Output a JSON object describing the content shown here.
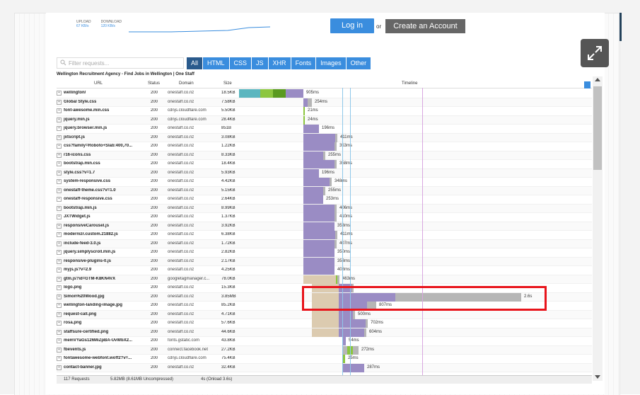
{
  "header": {
    "upload_label": "UPLOAD",
    "upload_value": "67 KB/s",
    "download_label": "DOWNLOAD",
    "download_value": "120 KB/s",
    "login_label": "Log in",
    "or_label": "or",
    "create_label": "Create an Account"
  },
  "filter": {
    "placeholder": "Filter requests...",
    "tabs": [
      "All",
      "HTML",
      "CSS",
      "JS",
      "XHR",
      "Fonts",
      "Images",
      "Other"
    ],
    "active_tab": "All"
  },
  "page_title": "Wellington Recruitment Agency - Find Jobs in Wellington | One Staff",
  "columns": {
    "url": "URL",
    "status": "Status",
    "domain": "Domain",
    "size": "Size",
    "timeline": "Timeline"
  },
  "colors": {
    "accent": "#3a8dde",
    "active_tab": "#2a5a8c",
    "highlight": "#e8141b",
    "bar_purple": "#9a8cc4",
    "bar_gray": "#b6b6b6",
    "bar_tan": "#dccbb0",
    "bar_teal": "#5bb6bf",
    "bar_green": "#8cc63f"
  },
  "rows": [
    {
      "url": "wellington/",
      "status": "200",
      "domain": "onestaff.co.nz",
      "size": "18.5KB",
      "time": "905ms"
    },
    {
      "url": "Global Style.css",
      "status": "200",
      "domain": "onestaff.co.nz",
      "size": "7.58KB",
      "time": "254ms"
    },
    {
      "url": "font-awesome.min.css",
      "status": "200",
      "domain": "cdnjs.cloudflare.com",
      "size": "5.50KB",
      "time": "21ms"
    },
    {
      "url": "jquery.min.js",
      "status": "200",
      "domain": "cdnjs.cloudflare.com",
      "size": "28.4KB",
      "time": "24ms"
    },
    {
      "url": "jquery.browser.min.js",
      "status": "200",
      "domain": "onestaff.co.nz",
      "size": "851B",
      "time": "196ms"
    },
    {
      "url": "jxtscript.js",
      "status": "200",
      "domain": "onestaff.co.nz",
      "size": "3.08KB",
      "time": "411ms"
    },
    {
      "url": "css?family=Roboto+Slab:400,70...",
      "status": "200",
      "domain": "onestaff.co.nz",
      "size": "1.22KB",
      "time": "353ms"
    },
    {
      "url": "r16-icons.css",
      "status": "200",
      "domain": "onestaff.co.nz",
      "size": "8.33KB",
      "time": "255ms"
    },
    {
      "url": "bootstrap.min.css",
      "status": "200",
      "domain": "onestaff.co.nz",
      "size": "18.4KB",
      "time": "358ms"
    },
    {
      "url": "style.css?v=1.7",
      "status": "200",
      "domain": "onestaff.co.nz",
      "size": "5.93KB",
      "time": "196ms"
    },
    {
      "url": "system-responsive.css",
      "status": "200",
      "domain": "onestaff.co.nz",
      "size": "4.42KB",
      "time": "348ms"
    },
    {
      "url": "onestaff-theme.css?v=1.0",
      "status": "200",
      "domain": "onestaff.co.nz",
      "size": "5.15KB",
      "time": "255ms"
    },
    {
      "url": "onestaff-responsive.css",
      "status": "200",
      "domain": "onestaff.co.nz",
      "size": "2.64KB",
      "time": "253ms"
    },
    {
      "url": "bootstrap.min.js",
      "status": "200",
      "domain": "onestaff.co.nz",
      "size": "8.99KB",
      "time": "406ms"
    },
    {
      "url": "JXTWidget.js",
      "status": "200",
      "domain": "onestaff.co.nz",
      "size": "1.37KB",
      "time": "410ms"
    },
    {
      "url": "responsiveCarousel.js",
      "status": "200",
      "domain": "onestaff.co.nz",
      "size": "3.92KB",
      "time": "353ms"
    },
    {
      "url": "modernizr.custom.21882.js",
      "status": "200",
      "domain": "onestaff.co.nz",
      "size": "6.38KB",
      "time": "411ms"
    },
    {
      "url": "include-feed-3.0.js",
      "status": "200",
      "domain": "onestaff.co.nz",
      "size": "1.72KB",
      "time": "407ms"
    },
    {
      "url": "jquery.simplyscroll.min.js",
      "status": "200",
      "domain": "onestaff.co.nz",
      "size": "2.82KB",
      "time": "350ms"
    },
    {
      "url": "responsive-plugins-0.js",
      "status": "200",
      "domain": "onestaff.co.nz",
      "size": "2.17KB",
      "time": "353ms"
    },
    {
      "url": "myjs.js?v=2.9",
      "status": "200",
      "domain": "onestaff.co.nz",
      "size": "4.25KB",
      "time": "408ms"
    },
    {
      "url": "gtm.js?id=GTM-K8KN4VX",
      "status": "200",
      "domain": "googletagmanager.c...",
      "size": "78.0KB",
      "time": "463ms"
    },
    {
      "url": "logo.png",
      "status": "200",
      "domain": "onestaff.co.nz",
      "size": "15.3KB",
      "time": ""
    },
    {
      "url": "Simon%20Wood.jpg",
      "status": "200",
      "domain": "onestaff.co.nz",
      "size": "3.85MB",
      "time": "2.6s"
    },
    {
      "url": "wellington-landing-image.jpg",
      "status": "200",
      "domain": "onestaff.co.nz",
      "size": "85.2KB",
      "time": "807ms"
    },
    {
      "url": "request-call.png",
      "status": "200",
      "domain": "onestaff.co.nz",
      "size": "4.71KB",
      "time": "500ms"
    },
    {
      "url": "rosa.png",
      "status": "200",
      "domain": "onestaff.co.nz",
      "size": "57.6KB",
      "time": "702ms"
    },
    {
      "url": "staffsure-certified.png",
      "status": "200",
      "domain": "onestaff.co.nz",
      "size": "44.6KB",
      "time": "604ms"
    },
    {
      "url": "memVYaGs126MiZpBA-UvWbX2...",
      "status": "200",
      "domain": "fonts.gstatic.com",
      "size": "43.8KB",
      "time": "54ms"
    },
    {
      "url": "fbevents.js",
      "status": "200",
      "domain": "connect.facebook.net",
      "size": "27.2KB",
      "time": "272ms"
    },
    {
      "url": "fontawesome-webfont.woff2?v=...",
      "status": "200",
      "domain": "cdnjs.cloudflare.com",
      "size": "75.4KB",
      "time": "25ms"
    },
    {
      "url": "contact-banner.jpg",
      "status": "200",
      "domain": "onestaff.co.nz",
      "size": "32.4KB",
      "time": "287ms"
    }
  ],
  "footer": {
    "requests": "117 Requests",
    "size": "5.82MB  (8.61MB Uncompressed)",
    "load": "4s  (Onload 3.6s)"
  }
}
